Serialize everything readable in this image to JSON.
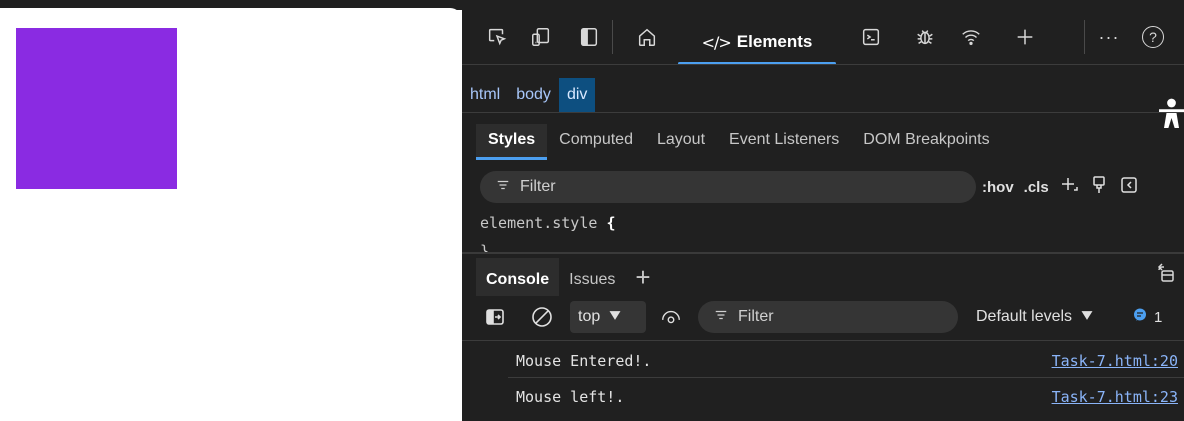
{
  "page": {
    "box_color": "#8a2be2"
  },
  "devtools": {
    "toolbar": {
      "elements_glyph": "</>",
      "elements_label": "Elements",
      "more_label": "···",
      "help_label": "?"
    },
    "breadcrumb": [
      "html",
      "body",
      "div"
    ],
    "styles_tabs": [
      "Styles",
      "Computed",
      "Layout",
      "Event Listeners",
      "DOM Breakpoints"
    ],
    "styles_filter_placeholder": "Filter",
    "hov_label": ":hov",
    "cls_label": ".cls",
    "rule_selector": "element.style",
    "rule_open": "{",
    "rule_close": "}",
    "drawer_tabs": [
      "Console",
      "Issues"
    ],
    "console": {
      "context": "top",
      "filter_placeholder": "Filter",
      "levels": "Default levels",
      "issues_count": "1",
      "messages": [
        {
          "text": "Mouse Entered!.",
          "source": "Task-7.html:20"
        },
        {
          "text": "Mouse left!.",
          "source": "Task-7.html:23"
        }
      ]
    },
    "colors": {
      "accent": "#4c9ff0",
      "link": "#8ab4f8",
      "background": "#202020"
    }
  }
}
